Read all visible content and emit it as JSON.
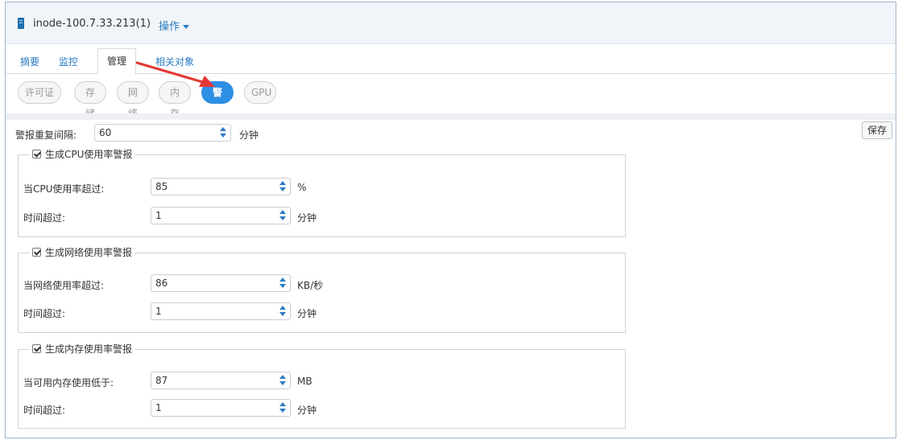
{
  "header": {
    "host_title": "inode-100.7.33.213(1)",
    "ops_label": "操作"
  },
  "tabs": [
    {
      "label": "摘要"
    },
    {
      "label": "监控"
    },
    {
      "label": "管理",
      "active": true
    },
    {
      "label": "相关对象"
    }
  ],
  "subtabs": [
    {
      "label": "许可证"
    },
    {
      "label": "存储"
    },
    {
      "label": "网络"
    },
    {
      "label": "内存"
    },
    {
      "label": "警报",
      "active": true
    },
    {
      "label": "GPU"
    }
  ],
  "alarm": {
    "interval_label": "警报重复间隔:",
    "interval_value": "60",
    "interval_unit": "分钟",
    "save_label": "保存"
  },
  "groups": [
    {
      "title": "生成CPU使用率警报",
      "checked": true,
      "rows": [
        {
          "label": "当CPU使用率超过:",
          "value": "85",
          "unit": "%"
        },
        {
          "label": "时间超过:",
          "value": "1",
          "unit": "分钟"
        }
      ]
    },
    {
      "title": "生成网络使用率警报",
      "checked": true,
      "rows": [
        {
          "label": "当网络使用率超过:",
          "value": "86",
          "unit": "KB/秒"
        },
        {
          "label": "时间超过:",
          "value": "1",
          "unit": "分钟"
        }
      ]
    },
    {
      "title": "生成内存使用率警报",
      "checked": true,
      "rows": [
        {
          "label": "当可用内存使用低于:",
          "value": "87",
          "unit": "MB"
        },
        {
          "label": "时间超过:",
          "value": "1",
          "unit": "分钟"
        }
      ]
    }
  ],
  "colors": {
    "accent": "#2e8fe6",
    "link": "#2a7bc4",
    "annotation_arrow": "#e53935"
  }
}
